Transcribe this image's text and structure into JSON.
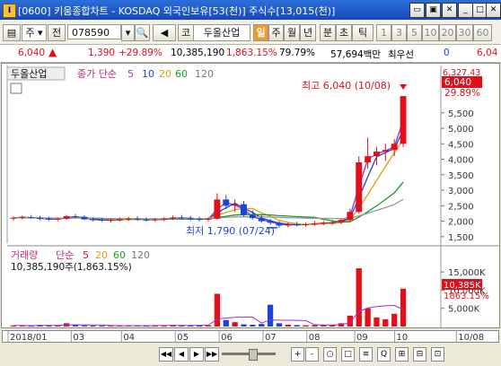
{
  "window": {
    "icon_label": "I",
    "title": "[0600] 키움종합차트 - KOSDAQ 외국인보유[53(천)] 주식수[13,015(천)]"
  },
  "toolbar": {
    "period": "주",
    "jeon_label": "전",
    "stock_code": "078590",
    "sound_label": "◀",
    "market_label": "코",
    "stock_name": "두올산업",
    "period_tabs": [
      "일",
      "주",
      "월",
      "년",
      "분",
      "초",
      "틱"
    ],
    "active_period": "일",
    "minute_tabs": [
      "1",
      "3",
      "5",
      "10",
      "20",
      "30",
      "60"
    ]
  },
  "quote": {
    "price": "6,040",
    "change": "1,390",
    "change_pct": "+29.89%",
    "volume": "10,385,190",
    "volume_ratio": "1,863.15%",
    "turnover": "79.79%",
    "trade_value": "57,694백만",
    "pref_label": "최우선",
    "pref_value": "0",
    "last_value": "6,04"
  },
  "chart_data": [
    {
      "type": "candlestick",
      "title": "두올산업",
      "legend": {
        "label": "종가 단순",
        "periods": [
          "5",
          "10",
          "20",
          "60",
          "120"
        ]
      },
      "y_ticks": [
        1500,
        2000,
        2500,
        3000,
        3500,
        4000,
        4500,
        5000,
        5500
      ],
      "y_tick_labels": [
        "1,500",
        "2,000",
        "2,500",
        "3,000",
        "3,500",
        "4,000",
        "4,500",
        "5,000",
        "5,500"
      ],
      "ylim": [
        1350,
        6450
      ],
      "current_price_label": "6,040",
      "current_pct_label": "29.89%",
      "top_axis_partial": "6,327.43",
      "annotation_high": "최고 6,040 (10/08)",
      "annotation_low": "최저 1,790 (07/24)",
      "ohlc_weekly": [
        [
          2080,
          2150,
          2020,
          2110
        ],
        [
          2110,
          2180,
          2060,
          2130
        ],
        [
          2130,
          2200,
          2080,
          2100
        ],
        [
          2100,
          2170,
          2030,
          2090
        ],
        [
          2090,
          2140,
          2010,
          2050
        ],
        [
          2050,
          2120,
          2000,
          2080
        ],
        [
          2080,
          2200,
          2050,
          2160
        ],
        [
          2160,
          2230,
          2100,
          2140
        ],
        [
          2140,
          2190,
          2040,
          2060
        ],
        [
          2060,
          2130,
          1990,
          2050
        ],
        [
          2050,
          2110,
          1980,
          2020
        ],
        [
          2020,
          2090,
          1960,
          2040
        ],
        [
          2040,
          2120,
          1990,
          2060
        ],
        [
          2060,
          2140,
          2010,
          2080
        ],
        [
          2080,
          2160,
          2020,
          2050
        ],
        [
          2050,
          2120,
          1990,
          2030
        ],
        [
          2030,
          2100,
          1980,
          2060
        ],
        [
          2060,
          2130,
          2000,
          2080
        ],
        [
          2080,
          2180,
          2040,
          2120
        ],
        [
          2120,
          2200,
          2060,
          2090
        ],
        [
          2090,
          2170,
          2030,
          2070
        ],
        [
          2070,
          2140,
          2000,
          2050
        ],
        [
          2050,
          2120,
          1990,
          2080
        ],
        [
          2080,
          2900,
          2050,
          2700
        ],
        [
          2700,
          2850,
          2400,
          2500
        ],
        [
          2500,
          2700,
          2300,
          2550
        ],
        [
          2550,
          2650,
          2150,
          2200
        ],
        [
          2200,
          2350,
          2050,
          2100
        ],
        [
          2100,
          2200,
          1950,
          2000
        ],
        [
          2000,
          2080,
          1880,
          1950
        ],
        [
          1950,
          2000,
          1790,
          1860
        ],
        [
          1860,
          1960,
          1800,
          1900
        ],
        [
          1900,
          1980,
          1830,
          1880
        ],
        [
          1880,
          1950,
          1820,
          1900
        ],
        [
          1900,
          2000,
          1850,
          1930
        ],
        [
          1930,
          2010,
          1870,
          1950
        ],
        [
          1950,
          2030,
          1890,
          1960
        ],
        [
          1960,
          2080,
          1900,
          2040
        ],
        [
          2040,
          2400,
          2000,
          2300
        ],
        [
          2300,
          4100,
          2250,
          3900
        ],
        [
          3900,
          4700,
          3700,
          4100
        ],
        [
          4100,
          4400,
          3800,
          4250
        ],
        [
          4250,
          4500,
          3950,
          4300
        ],
        [
          4300,
          4650,
          4100,
          4500
        ],
        [
          4500,
          6040,
          4400,
          6040
        ]
      ],
      "x_tick_labels": [
        "2018/01",
        "03",
        "04",
        "05",
        "06",
        "07",
        "08",
        "09",
        "10",
        "10/08"
      ]
    },
    {
      "type": "bar",
      "title": "거래량",
      "legend": {
        "label": "단순",
        "periods": [
          "5",
          "20",
          "60",
          "120"
        ]
      },
      "info_text": "10,385,190주(1,863.15%)",
      "y_ticks": [
        5000,
        10000,
        15000
      ],
      "y_tick_labels": [
        "5,000K",
        "10,000K",
        "15,000K"
      ],
      "ylim": [
        0,
        17500
      ],
      "current_label": "10,385K",
      "current_pct": "1863.15%",
      "values_k": [
        300,
        250,
        200,
        420,
        350,
        280,
        900,
        500,
        300,
        260,
        240,
        200,
        250,
        300,
        280,
        220,
        260,
        300,
        450,
        350,
        300,
        280,
        330,
        9000,
        1800,
        1200,
        600,
        500,
        700,
        6000,
        900,
        500,
        400,
        350,
        400,
        450,
        500,
        900,
        3000,
        16000,
        5000,
        2500,
        2000,
        3500,
        10385
      ]
    }
  ],
  "scroll": {
    "play_icons": [
      "◀◀",
      "◀",
      "▶",
      "▶▶"
    ],
    "btn_labels": [
      "+",
      "-",
      "○",
      "□",
      "≡",
      "Q",
      "⊞",
      "⊟",
      "⊡"
    ]
  }
}
